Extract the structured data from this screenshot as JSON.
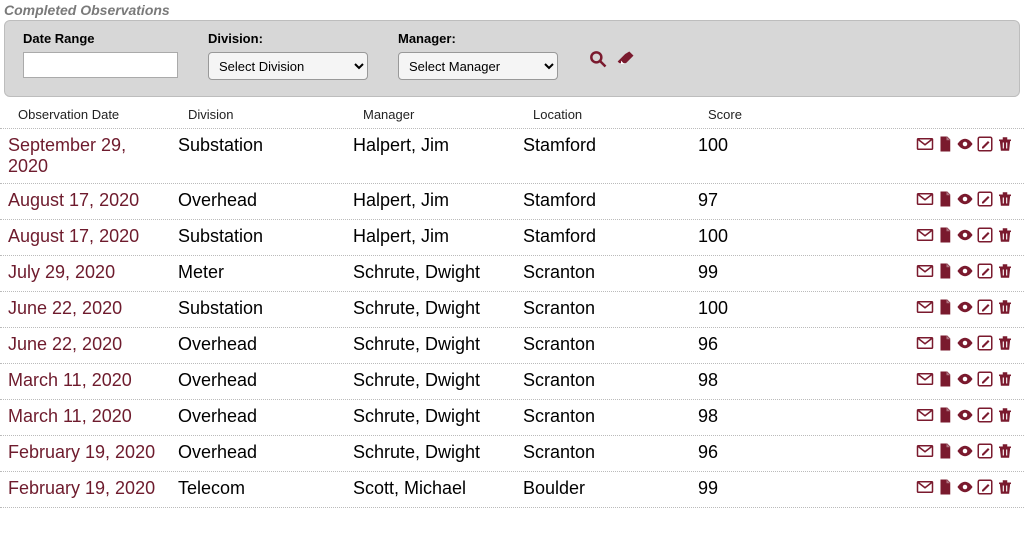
{
  "section_title": "Completed Observations",
  "filters": {
    "date_range": {
      "label": "Date Range",
      "value": ""
    },
    "division": {
      "label": "Division:",
      "placeholder": "Select Division"
    },
    "manager": {
      "label": "Manager:",
      "placeholder": "Select Manager"
    }
  },
  "columns": {
    "date": "Observation Date",
    "division": "Division",
    "manager": "Manager",
    "location": "Location",
    "score": "Score"
  },
  "rows": [
    {
      "date": "September 29, 2020",
      "division": "Substation",
      "manager": "Halpert, Jim",
      "location": "Stamford",
      "score": "100"
    },
    {
      "date": "August 17, 2020",
      "division": "Overhead",
      "manager": "Halpert, Jim",
      "location": "Stamford",
      "score": "97"
    },
    {
      "date": "August 17, 2020",
      "division": "Substation",
      "manager": "Halpert, Jim",
      "location": "Stamford",
      "score": "100"
    },
    {
      "date": "July 29, 2020",
      "division": "Meter",
      "manager": "Schrute, Dwight",
      "location": "Scranton",
      "score": "99"
    },
    {
      "date": "June 22, 2020",
      "division": "Substation",
      "manager": "Schrute, Dwight",
      "location": "Scranton",
      "score": "100"
    },
    {
      "date": "June 22, 2020",
      "division": "Overhead",
      "manager": "Schrute, Dwight",
      "location": "Scranton",
      "score": "96"
    },
    {
      "date": "March 11, 2020",
      "division": "Overhead",
      "manager": "Schrute, Dwight",
      "location": "Scranton",
      "score": "98"
    },
    {
      "date": "March 11, 2020",
      "division": "Overhead",
      "manager": "Schrute, Dwight",
      "location": "Scranton",
      "score": "98"
    },
    {
      "date": "February 19, 2020",
      "division": "Overhead",
      "manager": "Schrute, Dwight",
      "location": "Scranton",
      "score": "96"
    },
    {
      "date": "February 19, 2020",
      "division": "Telecom",
      "manager": "Scott, Michael",
      "location": "Boulder",
      "score": "99"
    }
  ],
  "icons": {
    "search": "search-icon",
    "clear": "eraser-icon",
    "email": "envelope-icon",
    "pdf": "file-pdf-icon",
    "view": "eye-icon",
    "edit": "edit-icon",
    "delete": "trash-icon"
  },
  "accent_color": "#7a1a2e"
}
